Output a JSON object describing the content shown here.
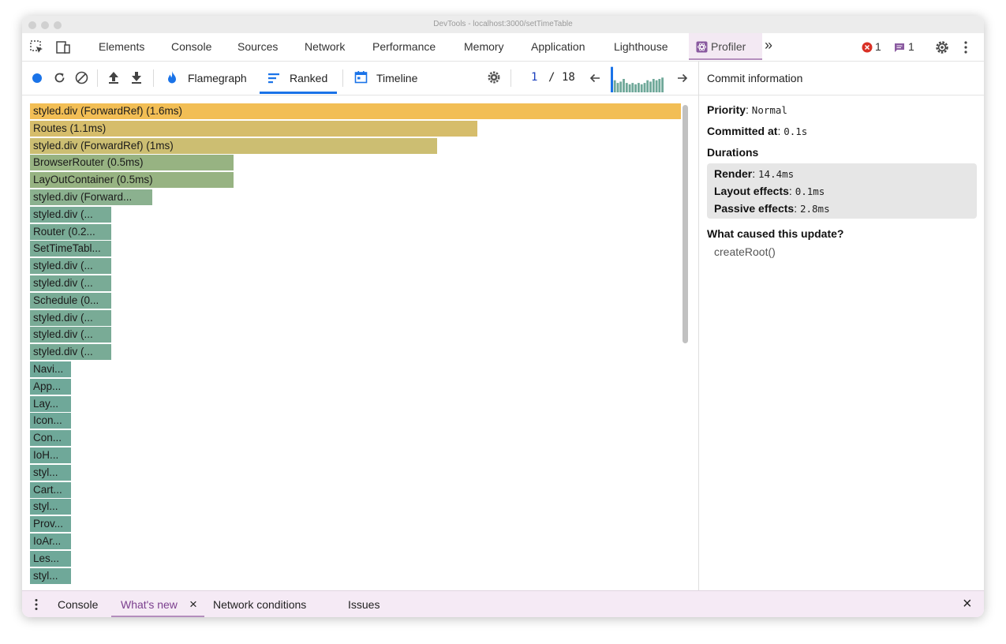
{
  "window": {
    "title": "DevTools - localhost:3000/setTimeTable"
  },
  "tabs": [
    "Elements",
    "Console",
    "Sources",
    "Network",
    "Performance",
    "Memory",
    "Application",
    "Lighthouse",
    "Profiler"
  ],
  "tabs_more": "»",
  "counters": {
    "errors": "1",
    "messages": "1"
  },
  "toolbar": {
    "flamegraph": "Flamegraph",
    "ranked": "Ranked",
    "timeline": "Timeline",
    "commit_current": "1",
    "commit_sep": "/",
    "commit_total": "18"
  },
  "bars": [
    {
      "label": "styled.div (ForwardRef) (1.6ms)",
      "value": 1.6,
      "color": "#f2be55"
    },
    {
      "label": "Routes (1.1ms)",
      "value": 1.1,
      "color": "#d6bd6b"
    },
    {
      "label": "styled.div (ForwardRef) (1ms)",
      "value": 1.0,
      "color": "#ccbe72"
    },
    {
      "label": "BrowserRouter (0.5ms)",
      "value": 0.5,
      "color": "#97b382"
    },
    {
      "label": "LayOutContainer (0.5ms)",
      "value": 0.5,
      "color": "#97b382"
    },
    {
      "label": "styled.div (Forward...",
      "value": 0.3,
      "color": "#8bb18f"
    },
    {
      "label": "styled.div (...",
      "value": 0.2,
      "color": "#79ab96"
    },
    {
      "label": "Router (0.2...",
      "value": 0.2,
      "color": "#79ab96"
    },
    {
      "label": "SetTimeTabl...",
      "value": 0.2,
      "color": "#79ab96"
    },
    {
      "label": "styled.div (...",
      "value": 0.2,
      "color": "#79ab96"
    },
    {
      "label": "styled.div (...",
      "value": 0.2,
      "color": "#79ab96"
    },
    {
      "label": "Schedule (0...",
      "value": 0.2,
      "color": "#79ab96"
    },
    {
      "label": "styled.div (...",
      "value": 0.2,
      "color": "#79ab96"
    },
    {
      "label": "styled.div (...",
      "value": 0.2,
      "color": "#79ab96"
    },
    {
      "label": "styled.div (...",
      "value": 0.2,
      "color": "#79ab96"
    },
    {
      "label": "Navi...",
      "value": 0.1,
      "color": "#6fa899"
    },
    {
      "label": "App...",
      "value": 0.1,
      "color": "#6fa899"
    },
    {
      "label": "Lay...",
      "value": 0.1,
      "color": "#6fa899"
    },
    {
      "label": "Icon...",
      "value": 0.1,
      "color": "#6fa899"
    },
    {
      "label": "Con...",
      "value": 0.1,
      "color": "#6fa899"
    },
    {
      "label": "IoH...",
      "value": 0.1,
      "color": "#6fa899"
    },
    {
      "label": "styl...",
      "value": 0.1,
      "color": "#6fa899"
    },
    {
      "label": "Cart...",
      "value": 0.1,
      "color": "#6fa899"
    },
    {
      "label": "styl...",
      "value": 0.1,
      "color": "#6fa899"
    },
    {
      "label": "Prov...",
      "value": 0.1,
      "color": "#6fa899"
    },
    {
      "label": "IoAr...",
      "value": 0.1,
      "color": "#6fa899"
    },
    {
      "label": "Les...",
      "value": 0.1,
      "color": "#6fa899"
    },
    {
      "label": "styl...",
      "value": 0.1,
      "color": "#6fa899"
    }
  ],
  "commit_bars": [
    0.95,
    0.45,
    0.35,
    0.4,
    0.5,
    0.35,
    0.3,
    0.35,
    0.3,
    0.35,
    0.3,
    0.35,
    0.45,
    0.4,
    0.5,
    0.45,
    0.5,
    0.55
  ],
  "commit_info": {
    "header": "Commit information",
    "priority_label": "Priority",
    "priority_value": "Normal",
    "committed_label": "Committed at",
    "committed_value": "0.1s",
    "durations_label": "Durations",
    "render_label": "Render",
    "render_value": "14.4ms",
    "layout_label": "Layout effects",
    "layout_value": "0.1ms",
    "passive_label": "Passive effects",
    "passive_value": "2.8ms",
    "cause_label": "What caused this update?",
    "cause_value": "createRoot()"
  },
  "drawer": {
    "tabs": [
      "Console",
      "What's new",
      "Network conditions",
      "Issues"
    ],
    "close_glyph": "×"
  },
  "colors": {
    "accent": "#1a73e8",
    "profiler_tab": "#b48ebd",
    "error": "#d93025"
  }
}
